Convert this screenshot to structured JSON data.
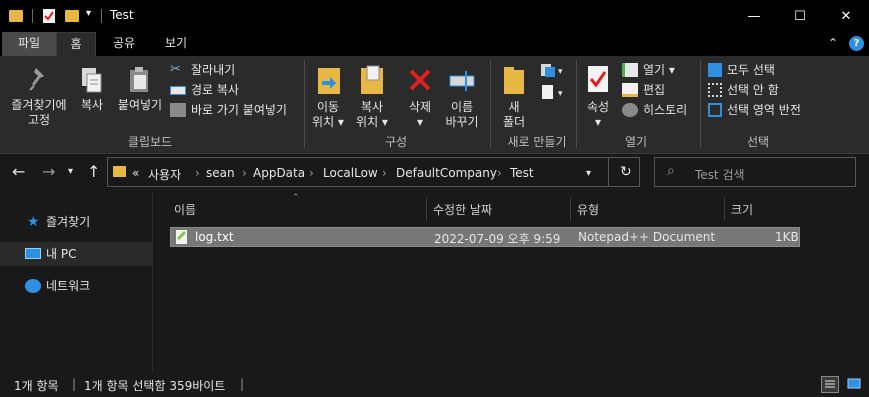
{
  "window": {
    "title": "Test",
    "controls": {
      "minimize": "—",
      "maximize": "☐",
      "close": "✕"
    }
  },
  "tabs": [
    {
      "label": "파일",
      "active": false
    },
    {
      "label": "홈",
      "active": true
    },
    {
      "label": "공유",
      "active": false
    },
    {
      "label": "보기",
      "active": false
    }
  ],
  "ribbon": {
    "clipboard": {
      "pin": "즐겨찾기에\n고정",
      "copy": "복사",
      "paste": "붙여넣기",
      "cut": "잘라내기",
      "copy_path": "경로 복사",
      "paste_shortcut": "바로 가기 붙여넣기",
      "group": "클립보드"
    },
    "organize": {
      "move": "이동\n위치 ▾",
      "copy_to": "복사\n위치 ▾",
      "delete": "삭제\n▾",
      "rename": "이름\n바꾸기",
      "group": "구성"
    },
    "new": {
      "new_folder": "새\n폴더",
      "group": "새로 만들기"
    },
    "open": {
      "properties": "속성\n▾",
      "open": "열기 ▾",
      "edit": "편집",
      "history": "히스토리",
      "group": "열기"
    },
    "select": {
      "select_all": "모두 선택",
      "select_none": "선택 안 함",
      "invert": "선택 영역 반전",
      "group": "선택"
    }
  },
  "address": {
    "prefix": "«",
    "crumbs": [
      "사용자",
      "sean",
      "AppData",
      "LocalLow",
      "DefaultCompany",
      "Test"
    ],
    "search_placeholder": "Test 검색"
  },
  "sidebar": {
    "items": [
      {
        "label": "즐겨찾기",
        "selected": false
      },
      {
        "label": "내 PC",
        "selected": true
      },
      {
        "label": "네트워크",
        "selected": false
      }
    ]
  },
  "columns": [
    "이름",
    "수정한 날짜",
    "유형",
    "크기"
  ],
  "files": [
    {
      "name": "log.txt",
      "modified": "2022-07-09 오후 9:59",
      "type": "Notepad++ Document",
      "size": "1KB"
    }
  ],
  "status": {
    "count": "1개 항목",
    "selected": "1개 항목 선택함 359바이트"
  },
  "colors": {
    "folder": "#e8b844",
    "accent_blue": "#2f8fe0",
    "delete_red": "#e02020"
  }
}
